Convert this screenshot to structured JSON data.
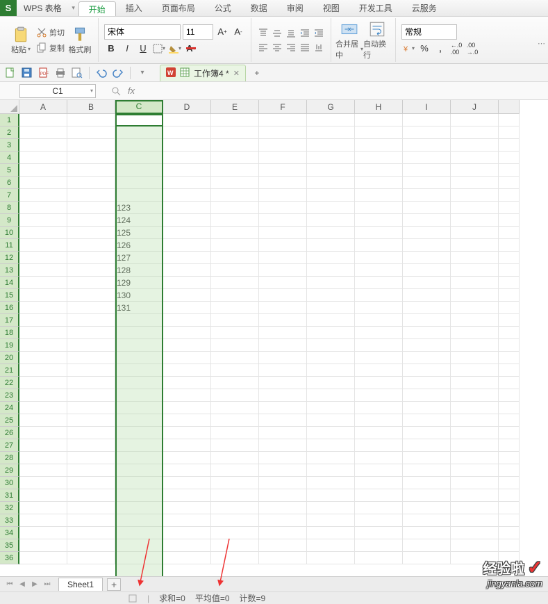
{
  "app": {
    "logo_letter": "S",
    "name": "WPS 表格"
  },
  "menu": {
    "tabs": [
      "开始",
      "插入",
      "页面布局",
      "公式",
      "数据",
      "审阅",
      "视图",
      "开发工具",
      "云服务"
    ],
    "active_index": 0
  },
  "ribbon": {
    "clipboard": {
      "paste": "粘贴",
      "cut": "剪切",
      "copy": "复制",
      "format_painter": "格式刷"
    },
    "font": {
      "family": "宋体",
      "size": "11",
      "increase": "A",
      "increase_sup": "+",
      "decrease": "A",
      "decrease_sup": "-",
      "bold": "B",
      "italic": "I",
      "underline": "U"
    },
    "merge": {
      "label": "合并居中"
    },
    "wrap": {
      "label": "自动换行"
    },
    "number": {
      "format_label": "常规",
      "percent": "%",
      "comma": ",",
      "inc_dec_1": ".0",
      "inc_dec_2": ".00"
    }
  },
  "doc": {
    "tab_title": "工作簿4 *"
  },
  "namebox": {
    "value": "C1"
  },
  "formula": {
    "fx": "fx",
    "value": ""
  },
  "columns": [
    "A",
    "B",
    "C",
    "D",
    "E",
    "F",
    "G",
    "H",
    "I",
    "J"
  ],
  "selected_col_index": 2,
  "row_count": 36,
  "cell_data": {
    "C8": "123",
    "C9": "124",
    "C10": "125",
    "C11": "126",
    "C12": "127",
    "C13": "128",
    "C14": "129",
    "C15": "130",
    "C16": "131"
  },
  "sheet": {
    "name": "Sheet1"
  },
  "status": {
    "sum": "求和=0",
    "avg": "平均值=0",
    "count": "计数=9"
  },
  "watermark": {
    "line1": "经验啦",
    "line2": "jingyanla.com"
  },
  "chart_data": null
}
